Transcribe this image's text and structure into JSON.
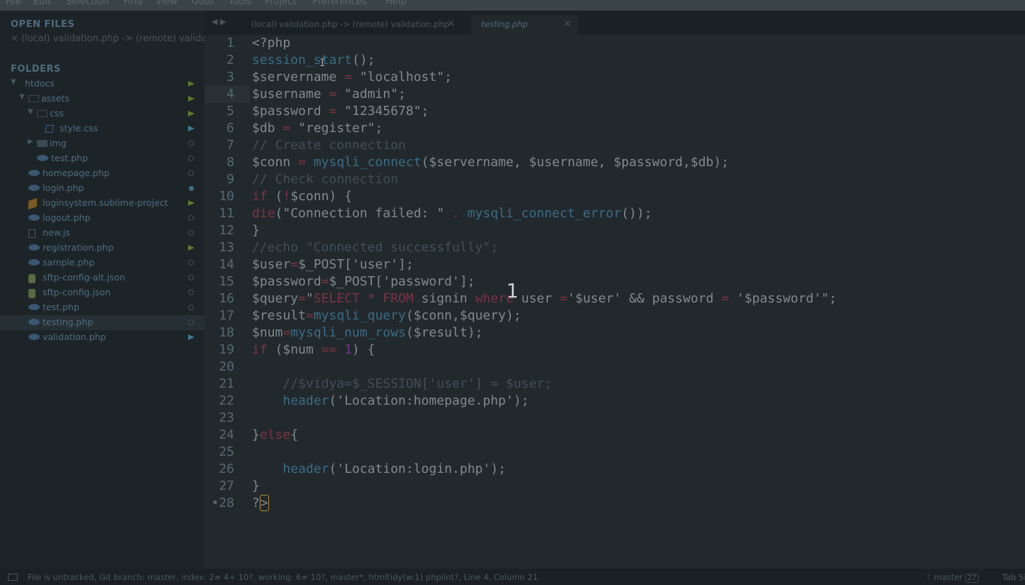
{
  "menu": [
    "File",
    "Edit",
    "Selection",
    "Find",
    "View",
    "Goto",
    "Tools",
    "Project",
    "Preferences",
    "Help"
  ],
  "sidebar": {
    "open_files_title": "OPEN FILES",
    "open_file": "× (local) validation.php -> (remote) validation.php",
    "folders_title": "FOLDERS",
    "tree": [
      {
        "label": "htdocs",
        "type": "folder-open",
        "depth": 0,
        "badge": "mod"
      },
      {
        "label": "assets",
        "type": "folder-open",
        "depth": 1,
        "badge": "mod"
      },
      {
        "label": "css",
        "type": "folder-open",
        "depth": 2,
        "badge": "mod"
      },
      {
        "label": "style.css",
        "type": "css",
        "depth": 3,
        "badge": "mod-blue"
      },
      {
        "label": "img",
        "type": "folder",
        "depth": 2,
        "badge": "untracked"
      },
      {
        "label": "test.php",
        "type": "php",
        "depth": 2,
        "badge": "untracked"
      },
      {
        "label": "homepage.php",
        "type": "php",
        "depth": 1,
        "badge": "untracked"
      },
      {
        "label": "login.php",
        "type": "php",
        "depth": 1,
        "badge": "staged"
      },
      {
        "label": "loginsystem.sublime-project",
        "type": "sub",
        "depth": 1,
        "badge": "mod"
      },
      {
        "label": "logout.php",
        "type": "php",
        "depth": 1,
        "badge": "untracked"
      },
      {
        "label": "new.js",
        "type": "js",
        "depth": 1,
        "badge": "untracked"
      },
      {
        "label": "registration.php",
        "type": "php",
        "depth": 1,
        "badge": "mod"
      },
      {
        "label": "sample.php",
        "type": "php",
        "depth": 1,
        "badge": "untracked"
      },
      {
        "label": "sftp-config-alt.json",
        "type": "json",
        "depth": 1,
        "badge": "untracked"
      },
      {
        "label": "sftp-config.json",
        "type": "json",
        "depth": 1,
        "badge": "untracked"
      },
      {
        "label": "test.php",
        "type": "php",
        "depth": 1,
        "badge": "untracked"
      },
      {
        "label": "testing.php",
        "type": "php",
        "depth": 1,
        "badge": "untracked",
        "selected": true
      },
      {
        "label": "validation.php",
        "type": "php",
        "depth": 1,
        "badge": "mod-blue"
      }
    ]
  },
  "tabs": [
    {
      "label": "(local) validation.php -> (remote) validation.php",
      "close": "×"
    },
    {
      "label": "testing.php",
      "close": "×",
      "active": true
    }
  ],
  "nav_arrows": "◀ ▶",
  "editor": {
    "line_numbers": [
      "1",
      "2",
      "3",
      "4",
      "5",
      "6",
      "7",
      "8",
      "9",
      "10",
      "11",
      "12",
      "13",
      "14",
      "15",
      "16",
      "17",
      "18",
      "19",
      "20",
      "21",
      "22",
      "23",
      "24",
      "25",
      "26",
      "27",
      "•28"
    ],
    "overlay_number": "1"
  },
  "status": {
    "text": "File is untracked, Git branch: master, index: 2≠ 4+ 10?, working: 6≠ 10?, master*, htmltidy(w:1) phplint?, Line 4, Column 21",
    "branch": "master",
    "branch_count": "27",
    "tab_size": "Tab Si"
  }
}
